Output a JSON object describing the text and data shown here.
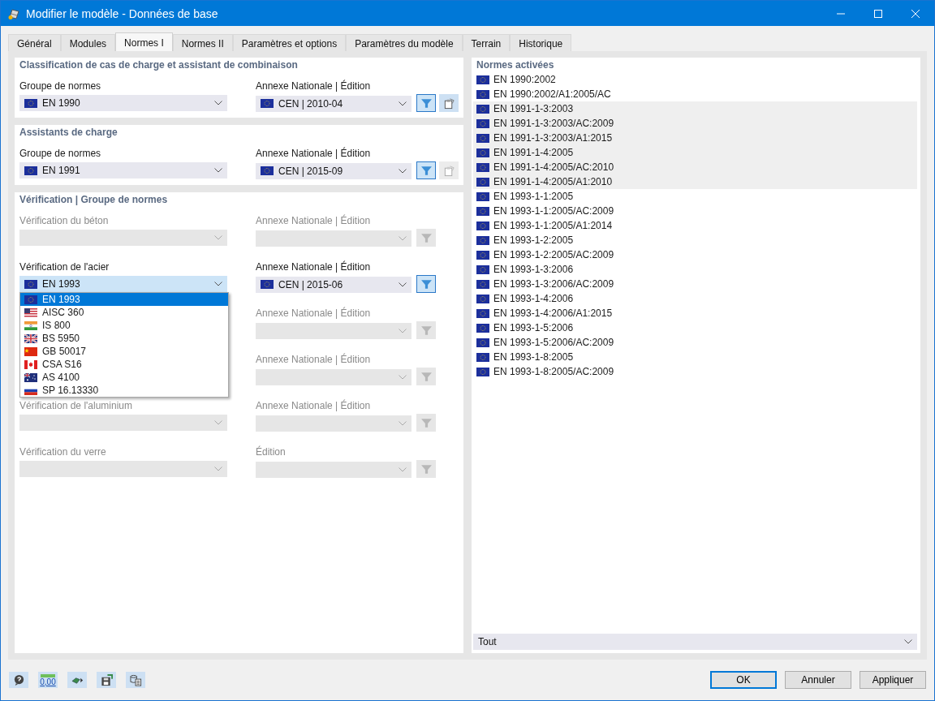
{
  "window": {
    "title": "Modifier le modèle - Données de base"
  },
  "tabs": [
    {
      "label": "Général",
      "selected": false
    },
    {
      "label": "Modules",
      "selected": false
    },
    {
      "label": "Normes I",
      "selected": true
    },
    {
      "label": "Normes II",
      "selected": false
    },
    {
      "label": "Paramètres et options",
      "selected": false
    },
    {
      "label": "Paramètres du modèle",
      "selected": false
    },
    {
      "label": "Terrain",
      "selected": false
    },
    {
      "label": "Historique",
      "selected": false
    }
  ],
  "sections": [
    {
      "title": "Classification de cas de charge et assistant de combinaison",
      "rows": [
        {
          "left": {
            "label": "Groupe de normes",
            "value": "EN 1990",
            "kind": "eu",
            "disabled": false,
            "focused": false
          },
          "right": {
            "label": "Annexe Nationale | Édition",
            "value": "CEN | 2010-04",
            "kind": "eu",
            "disabled": false
          },
          "filter": {
            "disabled": false
          },
          "paste": {
            "disabled": false
          }
        }
      ]
    },
    {
      "title": "Assistants de charge",
      "rows": [
        {
          "left": {
            "label": "Groupe de normes",
            "value": "EN 1991",
            "kind": "eu",
            "disabled": false,
            "focused": false
          },
          "right": {
            "label": "Annexe Nationale | Édition",
            "value": "CEN | 2015-09",
            "kind": "eu",
            "disabled": false
          },
          "filter": {
            "disabled": false
          },
          "paste": {
            "disabled": true
          }
        }
      ]
    },
    {
      "title": "Vérification | Groupe de normes",
      "rows": [
        {
          "left": {
            "label": "Vérification du béton",
            "disabled": true,
            "focused": false
          },
          "right": {
            "label": "Annexe Nationale | Édition",
            "disabled": true
          },
          "filter": {
            "disabled": true
          }
        },
        {
          "left": {
            "label": "Vérification de l'acier",
            "value": "EN 1993",
            "kind": "eu",
            "disabled": false,
            "focused": true,
            "options": [
              {
                "label": "EN 1993",
                "kind": "eu",
                "selected": true
              },
              {
                "label": "AISC 360",
                "kind": "us",
                "selected": false
              },
              {
                "label": "IS 800",
                "kind": "in",
                "selected": false
              },
              {
                "label": "BS 5950",
                "kind": "gb",
                "selected": false
              },
              {
                "label": "GB 50017",
                "kind": "cn",
                "selected": false
              },
              {
                "label": "CSA S16",
                "kind": "ca",
                "selected": false
              },
              {
                "label": "AS 4100",
                "kind": "au",
                "selected": false
              },
              {
                "label": "SP 16.13330",
                "kind": "ru",
                "selected": false
              }
            ]
          },
          "right": {
            "label": "Annexe Nationale | Édition",
            "value": "CEN | 2015-06",
            "kind": "eu",
            "disabled": false
          },
          "filter": {
            "disabled": false
          }
        },
        {
          "right": {
            "label": "Annexe Nationale | Édition",
            "disabled": true
          },
          "filter": {
            "disabled": true
          }
        },
        {
          "right": {
            "label": "Annexe Nationale | Édition",
            "disabled": true
          },
          "filter": {
            "disabled": true
          }
        },
        {
          "left": {
            "label": "Vérification de l'aluminium",
            "disabled": true,
            "focused": false
          },
          "right": {
            "label": "Annexe Nationale | Édition",
            "disabled": true
          },
          "filter": {
            "disabled": true
          }
        },
        {
          "left": {
            "label": "Vérification du verre",
            "disabled": true,
            "focused": false
          },
          "right": {
            "label": "Édition",
            "disabled": true
          },
          "filter": {
            "disabled": true
          }
        }
      ]
    }
  ],
  "active_standards": {
    "title": "Normes activées",
    "items": [
      {
        "label": "EN 1990:2002",
        "kind": "eu",
        "selected": false
      },
      {
        "label": "EN 1990:2002/A1:2005/AC",
        "kind": "eu",
        "selected": false
      },
      {
        "label": "EN 1991-1-3:2003",
        "kind": "eu",
        "selected": true
      },
      {
        "label": "EN 1991-1-3:2003/AC:2009",
        "kind": "eu",
        "selected": true
      },
      {
        "label": "EN 1991-1-3:2003/A1:2015",
        "kind": "eu",
        "selected": true
      },
      {
        "label": "EN 1991-1-4:2005",
        "kind": "eu",
        "selected": true
      },
      {
        "label": "EN 1991-1-4:2005/AC:2010",
        "kind": "eu",
        "selected": true
      },
      {
        "label": "EN 1991-1-4:2005/A1:2010",
        "kind": "eu",
        "selected": true
      },
      {
        "label": "EN 1993-1-1:2005",
        "kind": "eu",
        "selected": false
      },
      {
        "label": "EN 1993-1-1:2005/AC:2009",
        "kind": "eu",
        "selected": false
      },
      {
        "label": "EN 1993-1-1:2005/A1:2014",
        "kind": "eu",
        "selected": false
      },
      {
        "label": "EN 1993-1-2:2005",
        "kind": "eu",
        "selected": false
      },
      {
        "label": "EN 1993-1-2:2005/AC:2009",
        "kind": "eu",
        "selected": false
      },
      {
        "label": "EN 1993-1-3:2006",
        "kind": "eu",
        "selected": false
      },
      {
        "label": "EN 1993-1-3:2006/AC:2009",
        "kind": "eu",
        "selected": false
      },
      {
        "label": "EN 1993-1-4:2006",
        "kind": "eu",
        "selected": false
      },
      {
        "label": "EN 1993-1-4:2006/A1:2015",
        "kind": "eu",
        "selected": false
      },
      {
        "label": "EN 1993-1-5:2006",
        "kind": "eu",
        "selected": false
      },
      {
        "label": "EN 1993-1-5:2006/AC:2009",
        "kind": "eu",
        "selected": false
      },
      {
        "label": "EN 1993-1-8:2005",
        "kind": "eu",
        "selected": false
      },
      {
        "label": "EN 1993-1-8:2005/AC:2009",
        "kind": "eu",
        "selected": false
      }
    ],
    "filter": {
      "value": "Tout"
    }
  },
  "footer": {
    "tools": [
      {
        "kind": "help"
      },
      {
        "kind": "units",
        "text": "0,00"
      },
      {
        "kind": "model"
      },
      {
        "kind": "save"
      },
      {
        "kind": "library"
      }
    ],
    "buttons": [
      {
        "label": "OK",
        "default": true
      },
      {
        "label": "Annuler",
        "default": false
      },
      {
        "label": "Appliquer",
        "default": false
      }
    ]
  }
}
